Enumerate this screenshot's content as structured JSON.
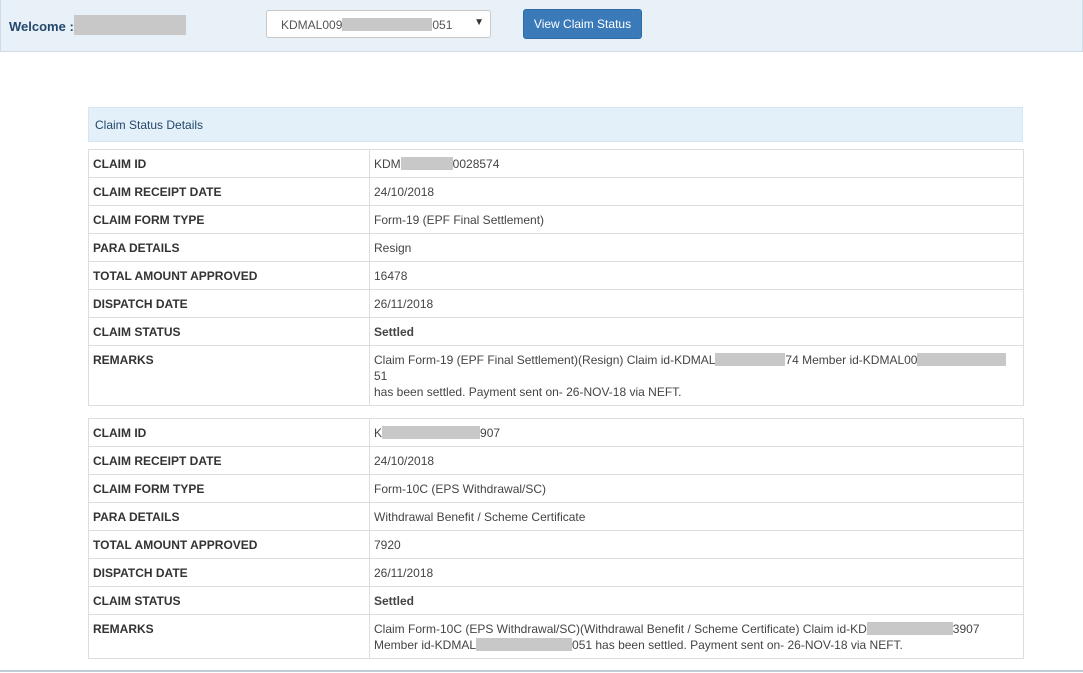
{
  "header": {
    "welcome_label": "Welcome :",
    "welcome_suffix": "...",
    "member_select_prefix": "KDMAL009",
    "member_select_suffix": "051",
    "view_button": "View Claim Status"
  },
  "panel_title": "Claim Status Details",
  "labels": {
    "claim_id": "CLAIM ID",
    "receipt_date": "CLAIM RECEIPT DATE",
    "form_type": "CLAIM FORM TYPE",
    "para_details": "PARA DETAILS",
    "amount": "TOTAL AMOUNT APPROVED",
    "dispatch_date": "DISPATCH DATE",
    "status": "CLAIM STATUS",
    "remarks": "REMARKS"
  },
  "claims": [
    {
      "claim_id_prefix": "KDM",
      "claim_id_suffix": "0028574",
      "receipt_date": "24/10/2018",
      "form_type": "Form-19 (EPF Final Settlement)",
      "para_details": "Resign",
      "amount": "16478",
      "dispatch_date": "26/11/2018",
      "status": "Settled",
      "remarks_a": "Claim Form-19 (EPF Final Settlement)(Resign) Claim id-KDMAL",
      "remarks_b": "74 Member id-KDMAL00",
      "remarks_c": "51",
      "remarks_d": "has been settled. Payment sent on- 26-NOV-18 via NEFT."
    },
    {
      "claim_id_prefix": "K",
      "claim_id_suffix": "907",
      "receipt_date": "24/10/2018",
      "form_type": "Form-10C (EPS Withdrawal/SC)",
      "para_details": "Withdrawal Benefit / Scheme Certificate",
      "amount": "7920",
      "dispatch_date": "26/11/2018",
      "status": "Settled",
      "remarks_a": "Claim Form-10C (EPS Withdrawal/SC)(Withdrawal Benefit / Scheme Certificate) Claim id-KD",
      "remarks_b": "3907",
      "remarks_c": "Member id-KDMAL",
      "remarks_d": "051 has been settled. Payment sent on- 26-NOV-18 via NEFT."
    }
  ],
  "colors": {
    "accent": "#3a7ab9",
    "settled": "#2e7d32",
    "header_bg": "#e8f1f8"
  }
}
